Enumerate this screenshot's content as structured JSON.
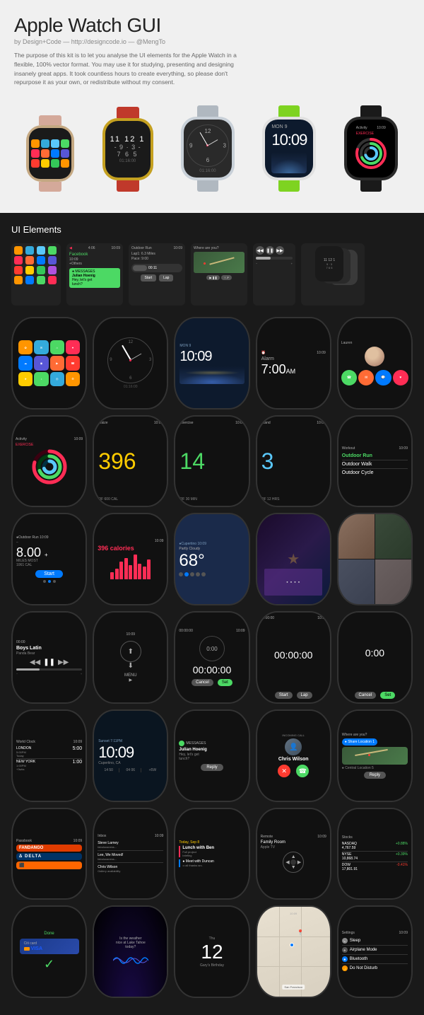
{
  "header": {
    "title": "Apple Watch GUI",
    "subtitle": "by Design+Code — http://designcode.io — @MengTo",
    "description": "The purpose of this kit is to let you analyse the UI elements for the Apple Watch in a flexible, 100% vector format. You may use it for studying, presenting and designing insanely great apps. It took countless hours to create everything, so please don't repurpose it as your own, or redistribute without my consent."
  },
  "sections": {
    "ui_elements": "UI Elements"
  },
  "watches": {
    "top_row": [
      {
        "band_color": "#d4a99a",
        "case_color": "#c4a882",
        "type": "icons"
      },
      {
        "band_color": "#c0392b",
        "case_color": "#c4a020",
        "type": "analog"
      },
      {
        "band_color": "#c0c0c0",
        "case_color": "#c0c0c0",
        "type": "analog_dark"
      },
      {
        "band_color": "#7ed321",
        "case_color": "#e0e0e0",
        "type": "digital_dark"
      },
      {
        "band_color": "#1a1a1a",
        "case_color": "#1a1a1a",
        "type": "activity"
      }
    ]
  },
  "times": {
    "main": "10:09",
    "mon9": "MON 9",
    "alarm": "7:00AM",
    "exercise_num": "14",
    "stand_num": "3",
    "workout_396": "396",
    "calories": "8.00",
    "timer_zero": "00:00:00",
    "stocks_nasdaq": "NASDAQ",
    "stocks_val1": "4,767.59",
    "stocks_nyse": "NYSE",
    "stocks_val2": "10,868.74",
    "stocks_dow": "DOW",
    "stocks_val3": "17,801.91",
    "london": "LONDON",
    "london_time": "5:00PM",
    "newyork": "NEW YORK",
    "newyork_time": "1:00PM",
    "workout_list": [
      "Outdoor Run",
      "Outdoor Walk",
      "Outdoor Cycle"
    ],
    "chris_wilson": "Chris Wilson",
    "julian": "Julian Hoenig",
    "message": "Hey, let's get lunch?",
    "reply_btn": "Reply",
    "incoming_call": "INCOMING CALL",
    "map_label": "Where are you?",
    "siri_label": "Thu\n12\nGary's Birthday",
    "settings_items": [
      "Sleep",
      "Airplane Mode",
      "Bluetooth",
      "Do Not Disturb"
    ],
    "san_francisco": "San Francisco",
    "done_label": "Done",
    "weather_question": "Is the weather nice at Lake Tahoe today?",
    "fandango": "FANDANGO",
    "delta": "delta",
    "inbox_label": "Inbox",
    "today_label": "Today, Sep 8",
    "lunch_label": "Lunch with Ben",
    "family_room": "Family Room",
    "apple_tv": "Apple TV",
    "remote_label": "Remote",
    "cancel_btn": "Cancel",
    "set_btn": "Set",
    "start_btn": "Start",
    "lap_btn": "Lap",
    "menu_btn": "MENU"
  }
}
